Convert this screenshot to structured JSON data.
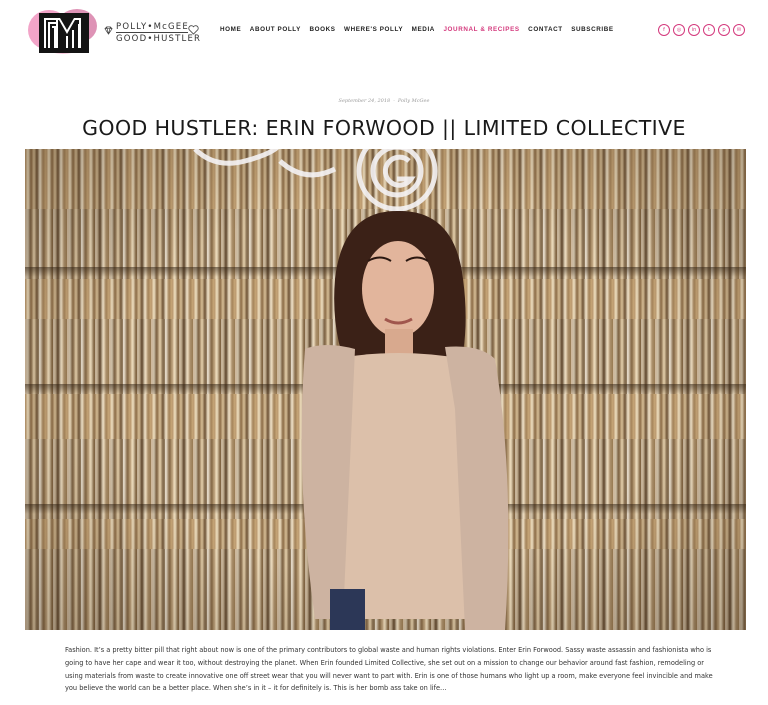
{
  "brand": {
    "logo_mark": "PM",
    "name_line1": "POLLY•McGEE",
    "name_line2": "GOOD•HUSTLER",
    "left_icon": "diamond-icon",
    "right_icon": "heart-icon"
  },
  "nav": {
    "items": [
      {
        "label": "HOME"
      },
      {
        "label": "ABOUT POLLY"
      },
      {
        "label": "BOOKS"
      },
      {
        "label": "WHERE'S POLLY"
      },
      {
        "label": "MEDIA"
      },
      {
        "label": "JOURNAL & RECIPES",
        "active": true
      },
      {
        "label": "CONTACT"
      },
      {
        "label": "SUBSCRIBE"
      }
    ]
  },
  "social": {
    "icons": [
      "facebook-icon",
      "instagram-icon",
      "linkedin-icon",
      "twitter-icon",
      "pinterest-icon",
      "email-icon"
    ],
    "glyphs": [
      "f",
      "◎",
      "in",
      "t",
      "p",
      "✉"
    ]
  },
  "post": {
    "date": "September 24, 2018",
    "author": "Polly McGee",
    "title": "GOOD HUSTLER: ERIN FORWOOD || LIMITED COLLECTIVE",
    "body": "Fashion. It’s a pretty bitter pill that right about now is one of the primary contributors to global waste and human rights violations. Enter Erin Forwood. Sassy waste assassin and fashionista who is going to have her cape and wear it too, without destroying the planet. When Erin founded Limited Collective, she set out on a mission to change our behavior around fast fashion, remodeling or using materials from waste to create innovative one off street wear that you will never want to part with. Erin is one of those humans who light up a room, make everyone feel invincible and make you believe the world can be a better place. When she’s in it – it for definitely is. This is her bomb ass take on life…"
  },
  "colors": {
    "accent": "#d4397d",
    "text": "#222222",
    "meta": "#9a9a9a"
  }
}
